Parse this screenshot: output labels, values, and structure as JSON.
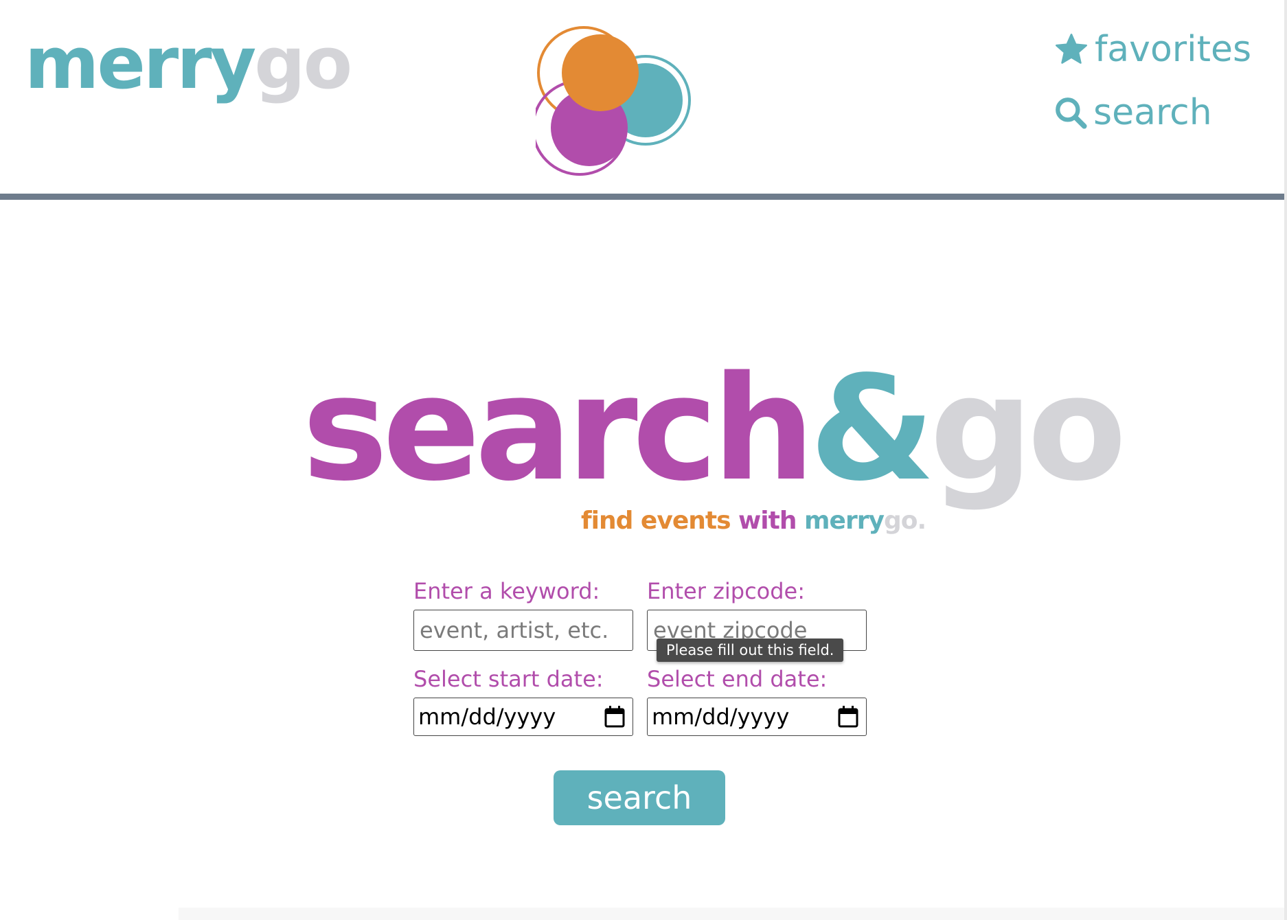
{
  "header": {
    "logo_merry": "merry",
    "logo_go": "go",
    "nav": {
      "favorites_label": "favorites",
      "search_label": "search"
    }
  },
  "hero": {
    "title_search": "search",
    "title_amp": "&",
    "title_go": "go",
    "tagline_find": "find events",
    "tagline_with": "with",
    "tagline_merry": "merry",
    "tagline_go": "go."
  },
  "form": {
    "keyword_label": "Enter a keyword:",
    "keyword_placeholder": "event, artist, etc.",
    "zipcode_label": "Enter zipcode:",
    "zipcode_placeholder": "event zipcode",
    "start_date_label": "Select start date:",
    "start_date_value": "mm/dd/yyyy",
    "end_date_label": "Select end date:",
    "end_date_value": "mm/dd/yyyy",
    "validation_tooltip": "Please fill out this field.",
    "submit_label": "search"
  },
  "icons": {
    "favorites": "star-icon",
    "search": "magnifier-icon",
    "date_picker": "calendar-icon"
  },
  "colors": {
    "teal": "#5fb1bb",
    "purple": "#b14dab",
    "orange": "#e38a34",
    "gray": "#d4d4d8",
    "divider": "#6e7c8c"
  }
}
